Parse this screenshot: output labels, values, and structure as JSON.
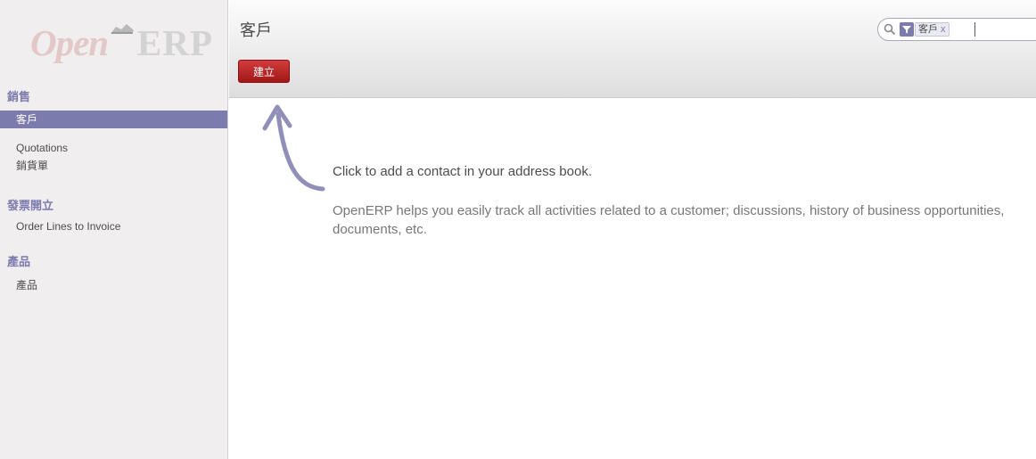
{
  "sidebar": {
    "logo": {
      "part1": "Open",
      "part2": "ERP"
    },
    "sections": [
      {
        "label": "銷售",
        "items": [
          {
            "label": "客戶",
            "active": true
          },
          {
            "label": "Quotations"
          },
          {
            "label": "銷貨單"
          }
        ]
      },
      {
        "label": "發票開立",
        "items": [
          {
            "label": "Order Lines to Invoice"
          }
        ]
      },
      {
        "label": "產品",
        "items": [
          {
            "label": "產品"
          }
        ]
      }
    ]
  },
  "header": {
    "title": "客戶",
    "create_label": "建立",
    "search": {
      "facet_value": "客戶",
      "facet_remove": "x",
      "value": ""
    }
  },
  "help": {
    "title": "Click to add a contact in your address book.",
    "body": "OpenERP helps you easily track all activities related to a customer; discussions, history of business opportunities, documents, etc."
  },
  "colors": {
    "accent": "#7c7bad",
    "create_button": "#c32a2a",
    "sidebar_bg": "#f0eeee"
  }
}
